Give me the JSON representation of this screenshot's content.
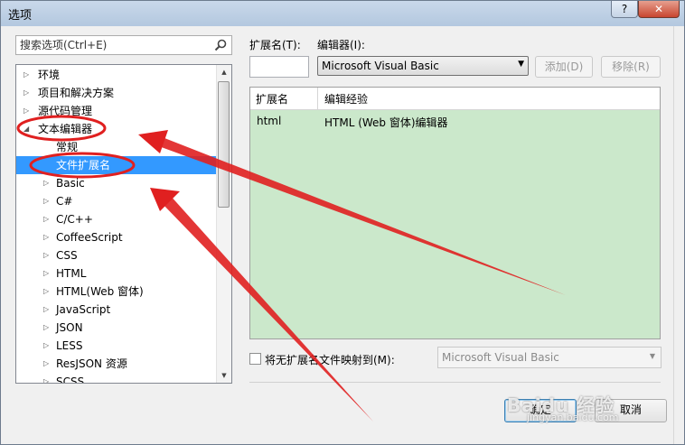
{
  "window": {
    "title": "选项",
    "help_glyph": "?",
    "close_glyph": "✕"
  },
  "search": {
    "placeholder": "搜索选项(Ctrl+E)"
  },
  "tree": {
    "items": [
      {
        "label": "环境",
        "expanded": false,
        "level": 0
      },
      {
        "label": "项目和解决方案",
        "expanded": false,
        "level": 0
      },
      {
        "label": "源代码管理",
        "expanded": false,
        "level": 0
      },
      {
        "label": "文本编辑器",
        "expanded": true,
        "level": 0
      },
      {
        "label": "常规",
        "level": 1
      },
      {
        "label": "文件扩展名",
        "level": 1,
        "selected": true
      },
      {
        "label": "Basic",
        "level": 1
      },
      {
        "label": "C#",
        "level": 1
      },
      {
        "label": "C/C++",
        "level": 1
      },
      {
        "label": "CoffeeScript",
        "level": 1
      },
      {
        "label": "CSS",
        "level": 1
      },
      {
        "label": "HTML",
        "level": 1
      },
      {
        "label": "HTML(Web 窗体)",
        "level": 1
      },
      {
        "label": "JavaScript",
        "level": 1
      },
      {
        "label": "JSON",
        "level": 1
      },
      {
        "label": "LESS",
        "level": 1
      },
      {
        "label": "ResJSON 资源",
        "level": 1
      },
      {
        "label": "SCSS",
        "level": 1
      }
    ]
  },
  "form": {
    "extension_label": "扩展名(T):",
    "editor_label": "编辑器(I):",
    "extension_value": "",
    "editor_selected": "Microsoft Visual Basic",
    "add_button": "添加(D)",
    "remove_button": "移除(R)"
  },
  "grid": {
    "columns": [
      "扩展名",
      "编辑经验"
    ],
    "rows": [
      [
        "html",
        "HTML (Web 窗体)编辑器"
      ]
    ]
  },
  "mapping": {
    "checkbox_label": "将无扩展名文件映射到(M):",
    "checked": false,
    "selected": "Microsoft Visual Basic"
  },
  "footer": {
    "ok_button": "确定",
    "cancel_button": "取消"
  },
  "watermark": {
    "text": "Baidu 经验",
    "sub": "jingyan.baidu.com"
  },
  "colors": {
    "selection": "#3399ff",
    "grid_background": "#cbe8cb",
    "annotation": "#e02020"
  }
}
